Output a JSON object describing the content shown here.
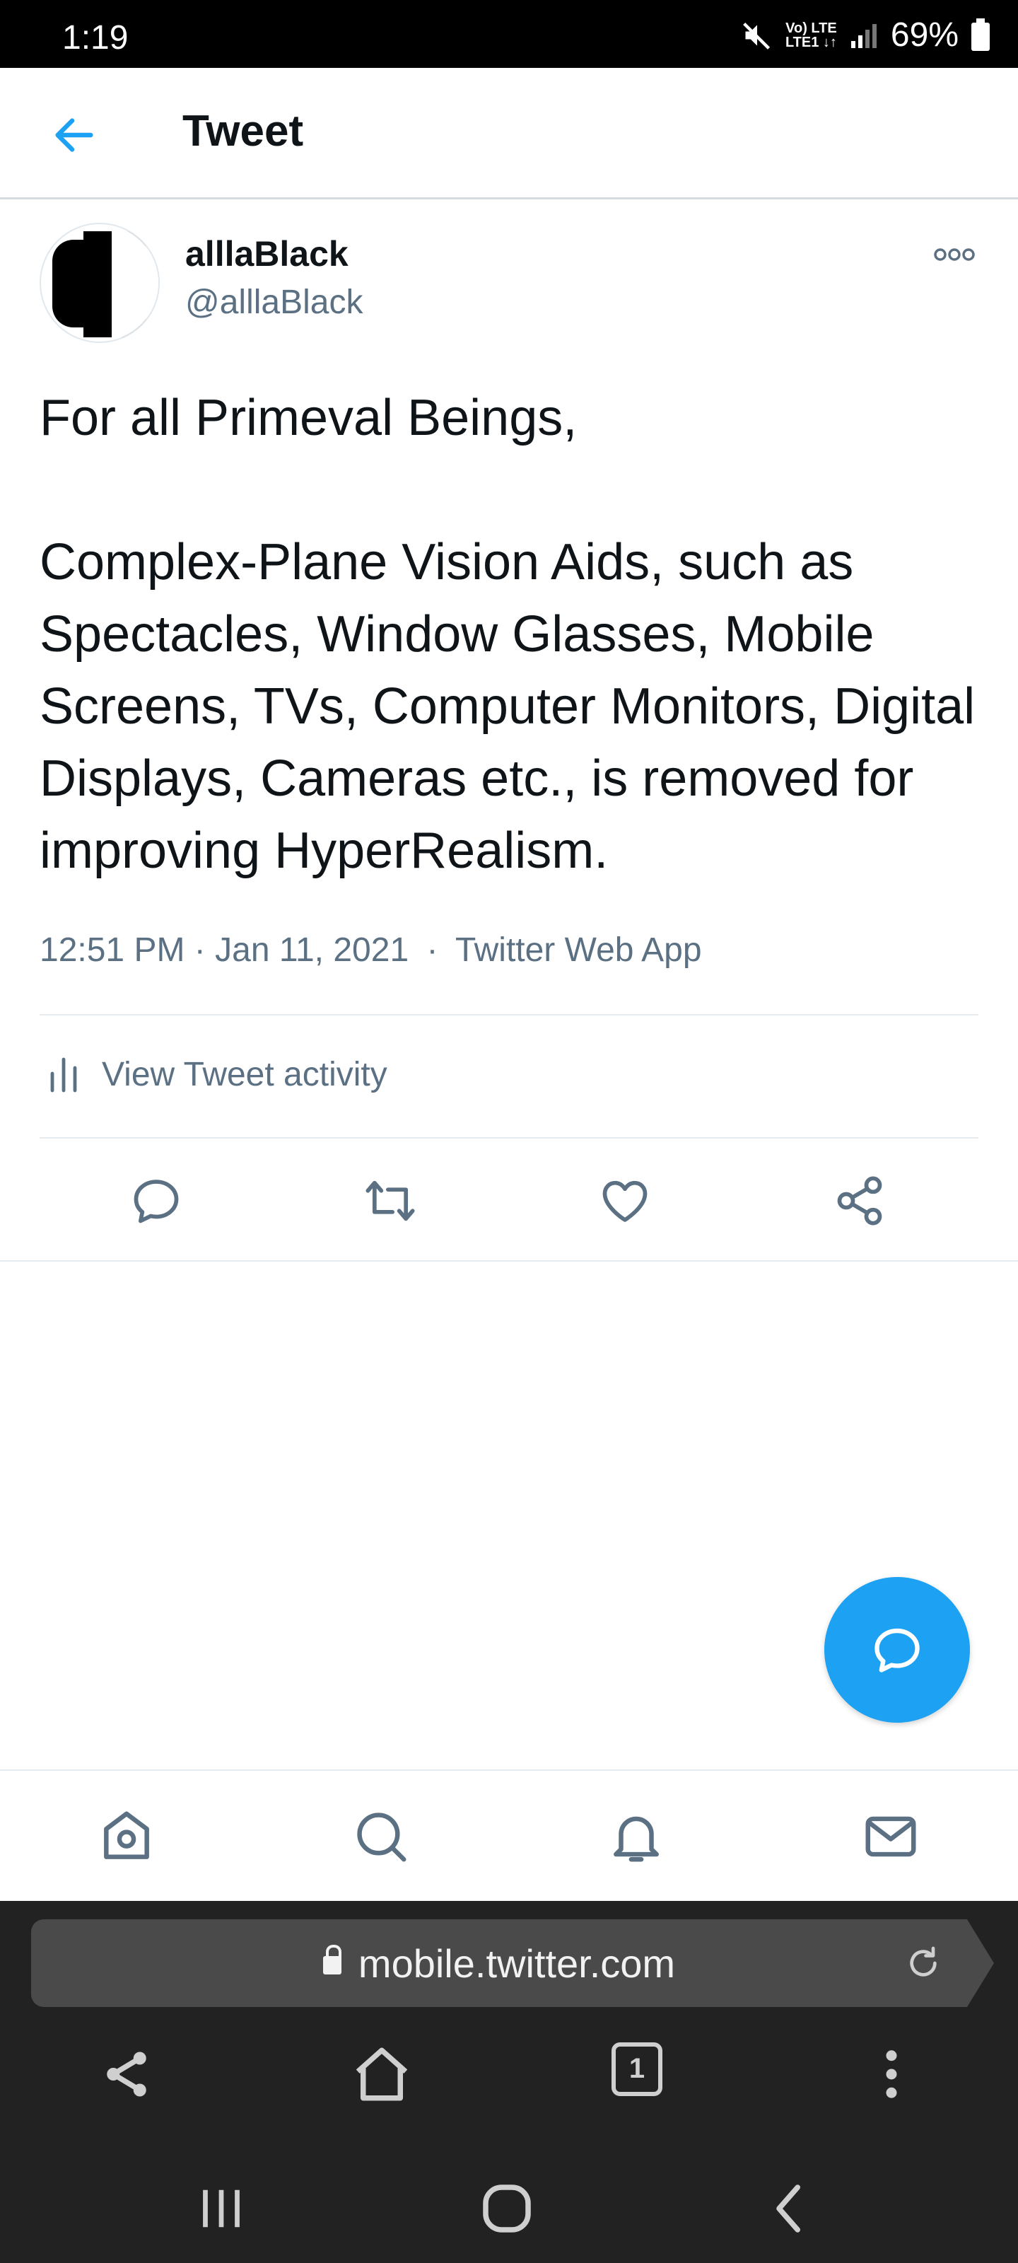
{
  "status_bar": {
    "time": "1:19",
    "network_top": "Vo) LTE",
    "network_bottom": "LTE1 ↓↑",
    "battery": "69%"
  },
  "header": {
    "title": "Tweet",
    "back_icon": "arrow-left-icon"
  },
  "tweet": {
    "display_name": "alllaBlack",
    "handle": "@alllaBlack",
    "text": "For all Primeval Beings,\n\nComplex-Plane Vision Aids, such as Spectacles, Window Glasses, Mobile Screens, TVs, Computer Monitors, Digital Displays, Cameras etc., is removed for improving HyperRealism.",
    "time": "12:51 PM",
    "date": "Jan 11, 2021",
    "source": "Twitter Web App",
    "dot": "·",
    "activity_label": "View Tweet activity"
  },
  "actions": [
    "reply-icon",
    "retweet-icon",
    "like-icon",
    "share-icon"
  ],
  "bottom_nav": [
    "home-icon",
    "search-icon",
    "notifications-icon",
    "messages-icon"
  ],
  "browser": {
    "url": "mobile.twitter.com",
    "tab_count": "1"
  },
  "colors": {
    "accent": "#1da1f2",
    "secondary_text": "#5b7083",
    "browser_bg": "#222222"
  }
}
